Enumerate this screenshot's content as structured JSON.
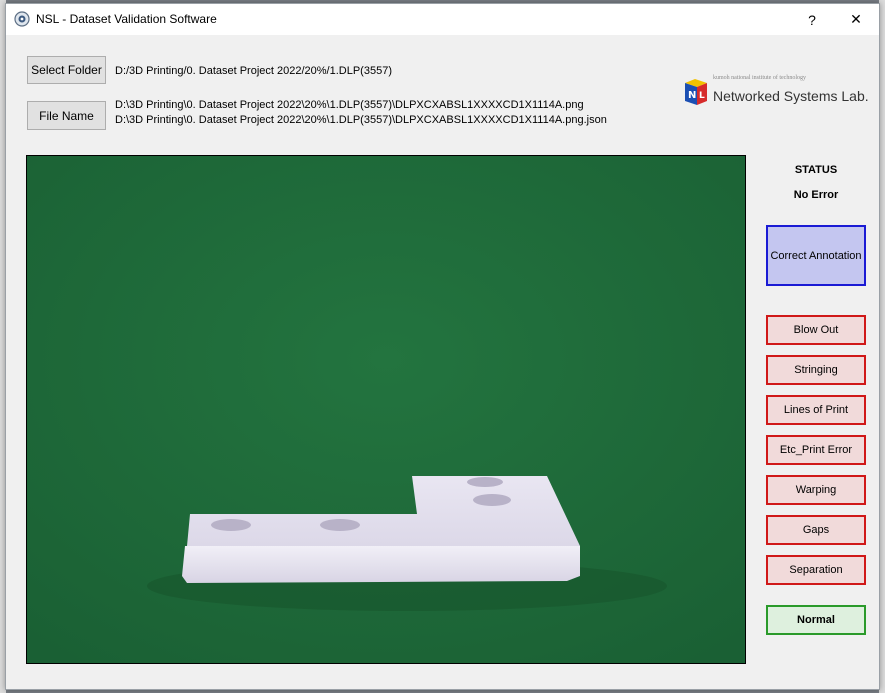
{
  "window": {
    "title": "NSL - Dataset Validation Software",
    "help_label": "?",
    "close_label": "✕"
  },
  "toolbar": {
    "select_folder_label": "Select Folder",
    "file_name_label": "File Name",
    "folder_path": "D:/3D Printing/0. Dataset Project 2022/20%/1.DLP(3557)",
    "image_path": "D:\\3D Printing\\0. Dataset Project 2022\\20%\\1.DLP(3557)\\DLPXCXABSL1XXXXCD1X1114A.png",
    "json_path": "D:\\3D Printing\\0. Dataset Project 2022\\20%\\1.DLP(3557)\\DLPXCXABSL1XXXXCD1X1114A.png.json"
  },
  "logo": {
    "small_text": "kumoh national institute of technology",
    "name": "Networked Systems Lab."
  },
  "status": {
    "title": "STATUS",
    "value": "No Error"
  },
  "actions": {
    "correct_label": "Correct Annotation",
    "errors": [
      {
        "label": "Blow Out"
      },
      {
        "label": "Stringing"
      },
      {
        "label": "Lines of Print"
      },
      {
        "label": "Etc_Print Error"
      },
      {
        "label": "Warping"
      },
      {
        "label": "Gaps"
      },
      {
        "label": "Separation"
      }
    ],
    "normal_label": "Normal"
  },
  "colors": {
    "background_green": "#1f6b3c",
    "correct_border": "#1a1ad4",
    "error_border": "#d01818",
    "normal_border": "#2a9a2a"
  }
}
